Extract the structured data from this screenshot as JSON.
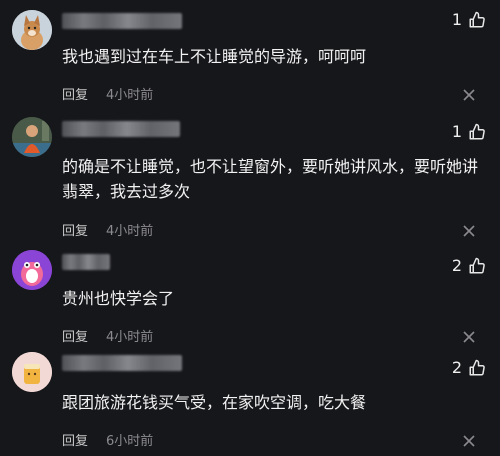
{
  "comments": [
    {
      "likes": "1",
      "text": "我也遇到过在车上不让睡觉的导游，呵呵呵",
      "reply_label": "回复",
      "time": "4小时前",
      "avatar_icon": "dog-avatar-icon"
    },
    {
      "likes": "1",
      "text": "的确是不让睡觉，也不让望窗外，要听她讲风水，要听她讲翡翠，我去过多次",
      "reply_label": "回复",
      "time": "4小时前",
      "avatar_icon": "person-avatar-icon"
    },
    {
      "likes": "2",
      "text": "贵州也快学会了",
      "reply_label": "回复",
      "time": "4小时前",
      "avatar_icon": "cartoon-avatar-icon"
    },
    {
      "likes": "2",
      "text": "跟团旅游花钱买气受，在家吹空调，吃大餐",
      "reply_label": "回复",
      "time": "6小时前",
      "avatar_icon": "drink-avatar-icon"
    }
  ],
  "colors": {
    "background": "#16171b",
    "text": "#f2f2f2",
    "meta": "#8b8b8f"
  }
}
